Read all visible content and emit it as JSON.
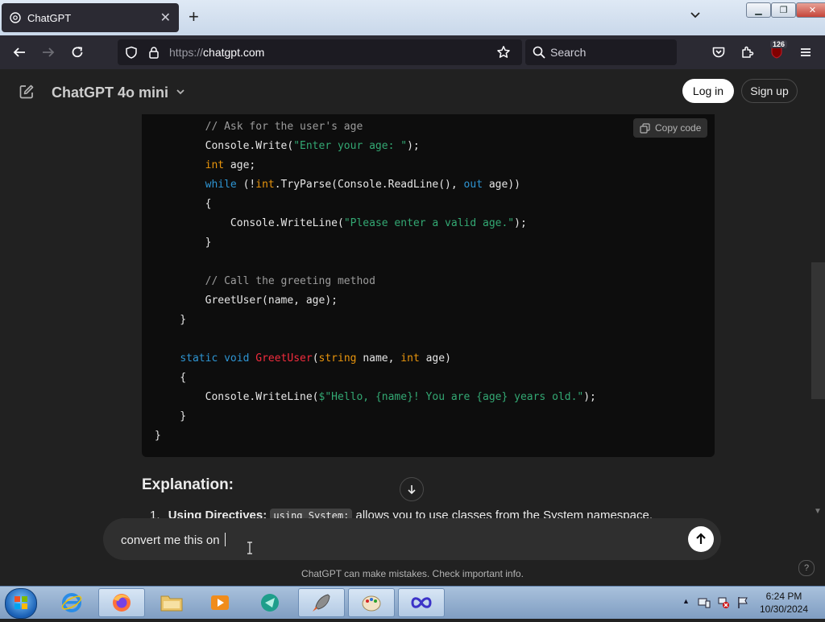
{
  "browser": {
    "tab_title": "ChatGPT",
    "url_proto": "https://",
    "url_host": "chatgpt.com",
    "search_label": "Search",
    "badge_count": "126"
  },
  "header": {
    "model_name": "ChatGPT 4o mini",
    "login_label": "Log in",
    "signup_label": "Sign up"
  },
  "code_block": {
    "copy_label": "Copy code",
    "lines": [
      [
        {
          "t": "        "
        },
        {
          "t": "// Ask for the user's age",
          "c": "c"
        }
      ],
      [
        {
          "t": "        Console.Write("
        },
        {
          "t": "\"Enter your age: \"",
          "c": "s"
        },
        {
          "t": ");"
        }
      ],
      [
        {
          "t": "        "
        },
        {
          "t": "int",
          "c": "t"
        },
        {
          "t": " age;"
        }
      ],
      [
        {
          "t": "        "
        },
        {
          "t": "while",
          "c": "k"
        },
        {
          "t": " (!"
        },
        {
          "t": "int",
          "c": "t"
        },
        {
          "t": ".TryParse(Console.ReadLine(), "
        },
        {
          "t": "out",
          "c": "k"
        },
        {
          "t": " age))"
        }
      ],
      [
        {
          "t": "        {"
        }
      ],
      [
        {
          "t": "            Console.WriteLine("
        },
        {
          "t": "\"Please enter a valid age.\"",
          "c": "s"
        },
        {
          "t": ");"
        }
      ],
      [
        {
          "t": "        }"
        }
      ],
      [
        {
          "t": ""
        }
      ],
      [
        {
          "t": "        "
        },
        {
          "t": "// Call the greeting method",
          "c": "c"
        }
      ],
      [
        {
          "t": "        GreetUser(name, age);"
        }
      ],
      [
        {
          "t": "    }"
        }
      ],
      [
        {
          "t": ""
        }
      ],
      [
        {
          "t": "    "
        },
        {
          "t": "static",
          "c": "k"
        },
        {
          "t": " "
        },
        {
          "t": "void",
          "c": "k"
        },
        {
          "t": " "
        },
        {
          "t": "GreetUser",
          "c": "f"
        },
        {
          "t": "("
        },
        {
          "t": "string",
          "c": "t"
        },
        {
          "t": " name, "
        },
        {
          "t": "int",
          "c": "t"
        },
        {
          "t": " age)"
        }
      ],
      [
        {
          "t": "    {"
        }
      ],
      [
        {
          "t": "        Console.WriteLine("
        },
        {
          "t": "$\"Hello, {name}! You are {age} years old.\"",
          "c": "s"
        },
        {
          "t": ");"
        }
      ],
      [
        {
          "t": "    }"
        }
      ],
      [
        {
          "t": "}"
        }
      ]
    ]
  },
  "explanation": {
    "heading": "Explanation:",
    "item_number": "1.",
    "item_bold": "Using Directives:",
    "item_code": "using System;",
    "item_text": "allows you to use classes from the System namespace."
  },
  "composer": {
    "input_text": "convert me this on "
  },
  "footer": {
    "disclaimer": "ChatGPT can make mistakes. Check important info.",
    "help_label": "?"
  },
  "taskbar": {
    "time": "6:24 PM",
    "date": "10/30/2024"
  }
}
